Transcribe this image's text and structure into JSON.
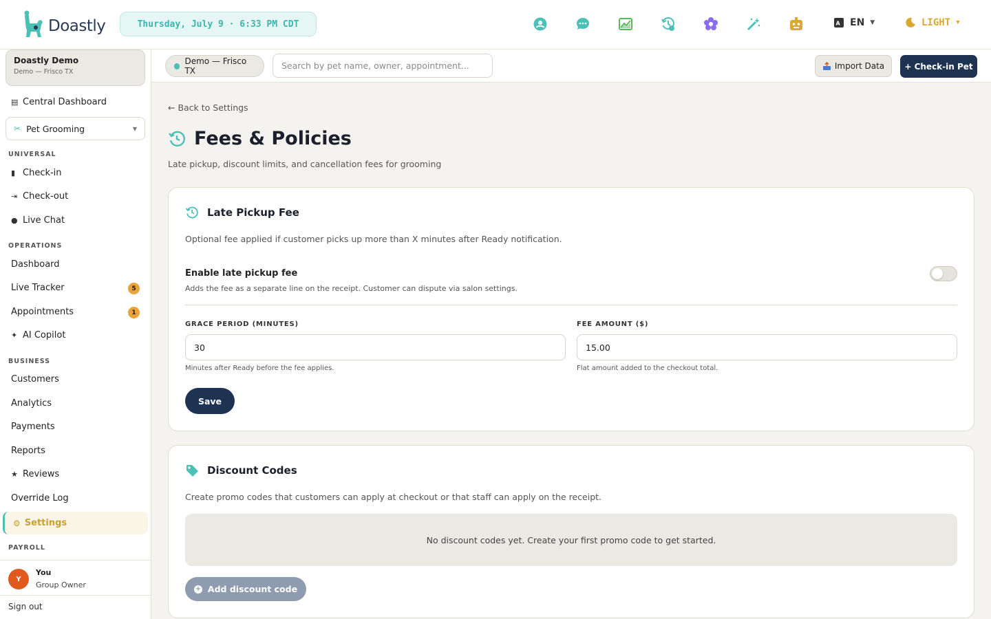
{
  "app": {
    "name": "Doastly"
  },
  "clock": "Thursday, July 9 · 6:33 PM CDT",
  "top_icons": [
    "support-icon",
    "chat-bubble-icon",
    "analytics-chart-icon",
    "clock-history-icon",
    "flower-icon",
    "magic-wand-icon",
    "robot-icon"
  ],
  "language": {
    "label": "EN"
  },
  "theme": {
    "label": "LIGHT"
  },
  "sidebar": {
    "org_name": "Doastly Demo",
    "org_sub": "Demo — Frisco TX",
    "central_dashboard": "Central Dashboard",
    "module": "Pet Grooming",
    "universal_label": "UNIVERSAL",
    "checkin": "Check-in",
    "checkout": "Check-out",
    "live_chat": "Live Chat",
    "operations_label": "OPERATIONS",
    "dashboard": "Dashboard",
    "live_tracker": "Live Tracker",
    "live_tracker_badge": "5",
    "appointments": "Appointments",
    "appointments_badge": "1",
    "ai_copilot": "AI Copilot",
    "business_label": "BUSINESS",
    "customers": "Customers",
    "analytics": "Analytics",
    "payments": "Payments",
    "reports": "Reports",
    "reviews": "Reviews",
    "override_log": "Override Log",
    "settings": "Settings",
    "payroll_label": "PAYROLL",
    "user_initial": "Y",
    "user_name": "You",
    "user_role": "Group Owner",
    "sign_out": "Sign out"
  },
  "subheader": {
    "location": "Demo — Frisco TX",
    "search_placeholder": "Search by pet name, owner, appointment...",
    "import_label": "Import Data",
    "checkin_label": "+ Check-in Pet"
  },
  "page": {
    "back": "← Back to Settings",
    "title": "Fees & Policies",
    "subtitle": "Late pickup, discount limits, and cancellation fees for grooming"
  },
  "late_fee": {
    "title": "Late Pickup Fee",
    "description": "Optional fee applied if customer picks up more than X minutes after Ready notification.",
    "toggle_title": "Enable late pickup fee",
    "toggle_desc": "Adds the fee as a separate line on the receipt. Customer can dispute via salon settings.",
    "toggle_enabled": false,
    "grace_label": "GRACE PERIOD (MINUTES)",
    "grace_value": "30",
    "grace_help": "Minutes after Ready before the fee applies.",
    "fee_label": "FEE AMOUNT ($)",
    "fee_value": "15.00",
    "fee_help": "Flat amount added to the checkout total.",
    "save_label": "Save"
  },
  "discounts": {
    "title": "Discount Codes",
    "description": "Create promo codes that customers can apply at checkout or that staff can apply on the receipt.",
    "empty": "No discount codes yet. Create your first promo code to get started.",
    "add_label": "Add discount code"
  },
  "colors": {
    "accent": "#4cc0b6",
    "navy": "#1e3352",
    "gold": "#c9a034",
    "badge": "#e8a33a"
  }
}
